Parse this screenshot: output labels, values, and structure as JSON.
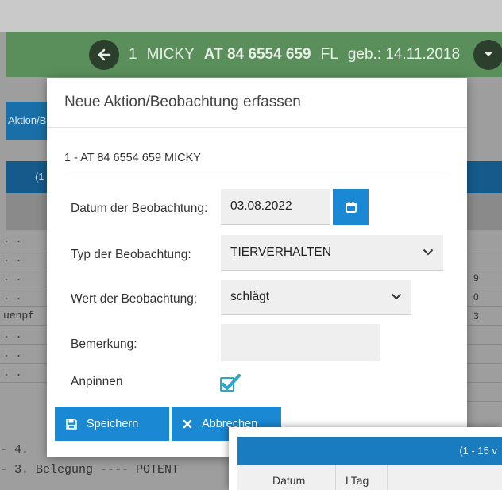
{
  "header": {
    "position": "1",
    "name": "MICKY",
    "ear_tag": "AT 84 6554 659",
    "breed": "FL",
    "birth": "geb.: 14.11.2018"
  },
  "background": {
    "tab_label": "Aktion/B",
    "band_label": "(1",
    "left_rows": [
      ". .",
      ". .",
      ". .",
      ". .",
      "uenpf",
      ". .",
      ". .",
      ". ."
    ],
    "right_col": [
      "",
      "",
      "9",
      "0",
      "3",
      "",
      "",
      "",
      "",
      ""
    ],
    "bottom_lines": [
      "- 4.",
      "- 3. Belegung ---- POTENT"
    ]
  },
  "modal": {
    "title": "Neue Aktion/Beobachtung erfassen",
    "subtitle": "1 - AT 84 6554 659 MICKY",
    "fields": {
      "date_label": "Datum der Beobachtung:",
      "date_value": "03.08.2022",
      "type_label": "Typ der Beobachtung:",
      "type_value": "TIERVERHALTEN",
      "value_label": "Wert der Beobachtung:",
      "value_value": "schlägt",
      "remark_label": "Bemerkung:",
      "remark_value": "",
      "pin_label": "Anpinnen"
    },
    "buttons": {
      "save": "Speichern",
      "cancel": "Abbrechen"
    }
  },
  "table_panel": {
    "range_label": "(1 - 15 v",
    "columns": [
      "Datum",
      "LTag"
    ]
  },
  "colors": {
    "primary": "#1a88d3",
    "header_green": "#5a8f5b",
    "check": "#2aa7c9"
  }
}
